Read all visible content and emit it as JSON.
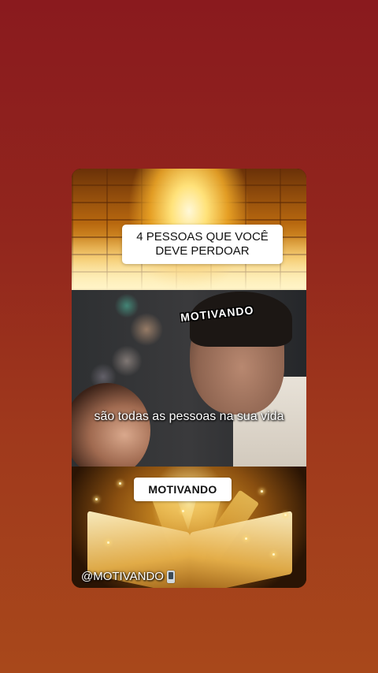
{
  "top_panel": {
    "title": "4 PESSOAS QUE VOCÊ DEVE PERDOAR"
  },
  "middle_panel": {
    "watermark_arc": "MOTIVANDO",
    "subtitle": "são todas as pessoas na sua vida"
  },
  "bottom_panel": {
    "label": "MOTIVANDO",
    "handle": "@MOTIVANDO",
    "handle_icon": "phone-icon"
  },
  "colors": {
    "background_top": "#8a1a1e",
    "background_bottom": "#a8481b",
    "gold": "#e9a62a"
  }
}
